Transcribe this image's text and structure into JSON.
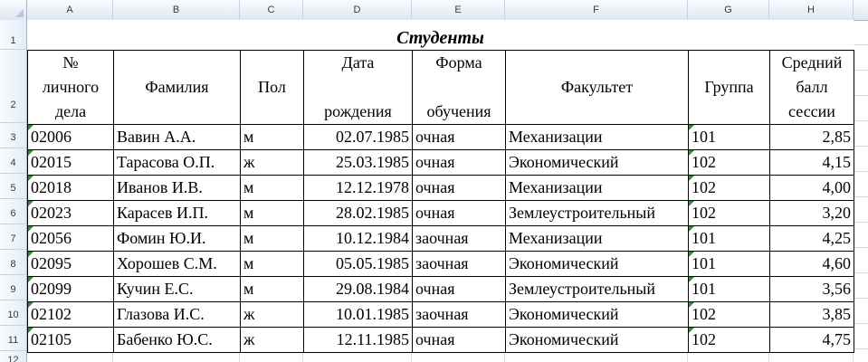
{
  "columns": [
    "A",
    "B",
    "C",
    "D",
    "E",
    "F",
    "G",
    "H"
  ],
  "rows": [
    "1",
    "2",
    "3",
    "4",
    "5",
    "6",
    "7",
    "8",
    "9",
    "10",
    "11",
    "12"
  ],
  "title": "Студенты",
  "headers": {
    "id": [
      "№",
      "личного",
      "дела"
    ],
    "surname": "Фамилия",
    "sex": "Пол",
    "birth": [
      "Дата",
      "",
      "рождения"
    ],
    "study_form": [
      "Форма",
      "",
      "обучения"
    ],
    "faculty": "Факультет",
    "group": "Группа",
    "avg": [
      "Средний",
      "балл",
      "сессии"
    ]
  },
  "records": [
    {
      "id": "02006",
      "surname": "Вавин А.А.",
      "sex": "м",
      "birth": "02.07.1985",
      "form": "очная",
      "faculty": "Механизации",
      "group": "101",
      "avg": "2,85"
    },
    {
      "id": "02015",
      "surname": "Тарасова О.П.",
      "sex": "ж",
      "birth": "25.03.1985",
      "form": "очная",
      "faculty": "Экономический",
      "group": "102",
      "avg": "4,15"
    },
    {
      "id": "02018",
      "surname": "Иванов И.В.",
      "sex": "м",
      "birth": "12.12.1978",
      "form": "очная",
      "faculty": "Механизации",
      "group": "102",
      "avg": "4,00"
    },
    {
      "id": "02023",
      "surname": "Карасев И.П.",
      "sex": "м",
      "birth": "28.02.1985",
      "form": "очная",
      "faculty": "Землеустроительный",
      "group": "102",
      "avg": "3,20"
    },
    {
      "id": "02056",
      "surname": "Фомин Ю.И.",
      "sex": "м",
      "birth": "10.12.1984",
      "form": "заочная",
      "faculty": "Механизации",
      "group": "101",
      "avg": "4,25"
    },
    {
      "id": "02095",
      "surname": "Хорошев С.М.",
      "sex": "м",
      "birth": "05.05.1985",
      "form": "заочная",
      "faculty": "Экономический",
      "group": "101",
      "avg": "4,60"
    },
    {
      "id": "02099",
      "surname": "Кучин Е.С.",
      "sex": "м",
      "birth": "29.08.1984",
      "form": "очная",
      "faculty": "Землеустроительный",
      "group": "101",
      "avg": "3,56"
    },
    {
      "id": "02102",
      "surname": "Глазова И.С.",
      "sex": "ж",
      "birth": "10.01.1985",
      "form": "заочная",
      "faculty": "Экономический",
      "group": "102",
      "avg": "3,85"
    },
    {
      "id": "02105",
      "surname": "Бабенко Ю.С.",
      "sex": "ж",
      "birth": "12.11.1985",
      "form": "очная",
      "faculty": "Экономический",
      "group": "102",
      "avg": "4,75"
    }
  ],
  "colors": {
    "header_bg": "#dfe7f2",
    "header_text": "#27413e",
    "gridline": "#dadcdd",
    "error_marker": "#2d8c2d"
  }
}
